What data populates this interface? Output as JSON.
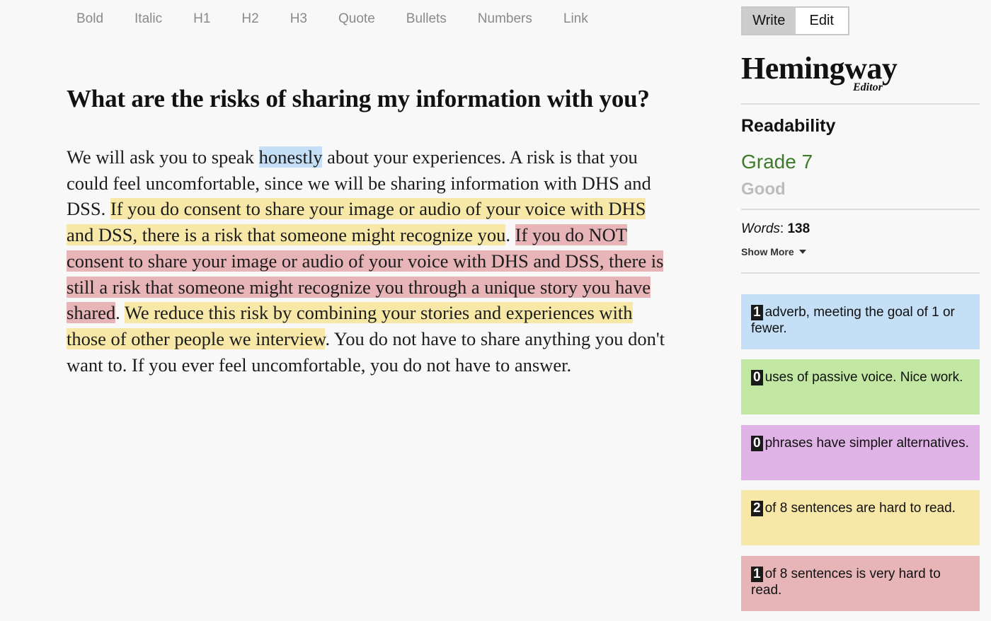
{
  "toolbar": {
    "bold": "Bold",
    "italic": "Italic",
    "h1": "H1",
    "h2": "H2",
    "h3": "H3",
    "quote": "Quote",
    "bullets": "Bullets",
    "numbers": "Numbers",
    "link": "Link"
  },
  "document": {
    "title": "What are the risks of sharing my information with you?",
    "segments": {
      "s1": "We will ask you to speak ",
      "s2_adverb": "honestly",
      "s3": " about your experiences. A risk is that you could feel uncomfortable, since we will be sharing information with DHS and DSS. ",
      "s4_hard": "If you do consent to share your image or audio of your voice with DHS and DSS, there is a risk that someone might recognize you",
      "s5": ". ",
      "s6_veryhard": "If you do NOT consent to share your image or audio of your voice with DHS and DSS, there is still a risk that someone might recognize you through a unique story you have shared",
      "s7": ". ",
      "s8_hard": "We reduce this risk by combining your stories and experiences with those of other people we interview",
      "s9": ". You do not have to share anything you don't want to. If you ever feel uncomfortable, you do not have to answer."
    }
  },
  "sidebar": {
    "mode": {
      "write": "Write",
      "edit": "Edit",
      "active": "write"
    },
    "logo": {
      "main": "Hemingway",
      "sub": "Editor"
    },
    "readability": {
      "heading": "Readability",
      "grade": "Grade 7",
      "description": "Good"
    },
    "words": {
      "label": "Words",
      "separator": ": ",
      "value": "138"
    },
    "show_more": "Show More",
    "cards": {
      "adverb": {
        "count": "1",
        "text": "adverb, meeting the goal of 1 or fewer."
      },
      "passive": {
        "count": "0",
        "text": "uses of passive voice. Nice work."
      },
      "phrases": {
        "count": "0",
        "text": "phrases have simpler alternatives."
      },
      "hard": {
        "count": "2",
        "text": "of 8 sentences are hard to read."
      },
      "very_hard": {
        "count": "1",
        "text": "of 8 sentences is very hard to read."
      }
    }
  },
  "colors": {
    "adverb_highlight": "#c4dff6",
    "passive_highlight": "#c2e7a2",
    "phrases_highlight": "#e0b3e6",
    "hard_highlight": "#f7e8a8",
    "very_hard_highlight": "#e7b5b8",
    "grade_text": "#3d7a29"
  },
  "icons": {
    "show_more": "caret-down-icon"
  }
}
